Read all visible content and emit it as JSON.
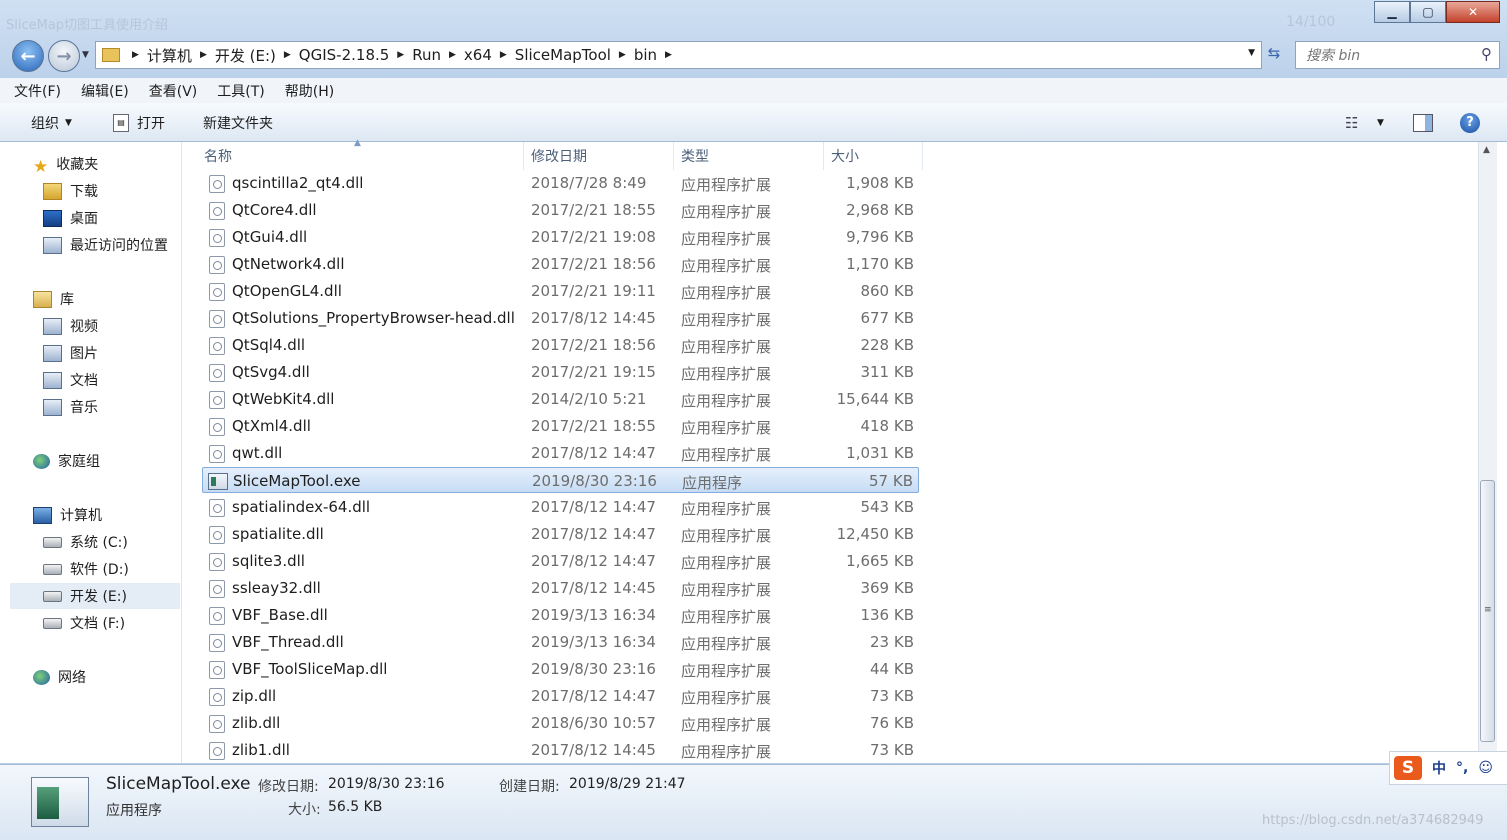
{
  "window": {
    "ghost_title_left": "SliceMap切图工具使用介绍",
    "ghost_title_right": "14/100"
  },
  "address": {
    "crumbs": [
      "计算机",
      "开发 (E:)",
      "QGIS-2.18.5",
      "Run",
      "x64",
      "SliceMapTool",
      "bin"
    ],
    "search_placeholder": "搜索 bin"
  },
  "menubar": [
    "文件(F)",
    "编辑(E)",
    "查看(V)",
    "工具(T)",
    "帮助(H)"
  ],
  "toolbar": {
    "organize": "组织",
    "open": "打开",
    "new_folder": "新建文件夹"
  },
  "nav": {
    "favorites": "收藏夹",
    "fav_items": [
      "下载",
      "桌面",
      "最近访问的位置"
    ],
    "libraries": "库",
    "lib_items": [
      "视频",
      "图片",
      "文档",
      "音乐"
    ],
    "homegroup": "家庭组",
    "computer": "计算机",
    "drives": [
      "系统 (C:)",
      "软件 (D:)",
      "开发 (E:)",
      "文档 (F:)"
    ],
    "network": "网络"
  },
  "columns": {
    "name": "名称",
    "date": "修改日期",
    "type": "类型",
    "size": "大小"
  },
  "files": [
    {
      "name": "qscintilla2_qt4.dll",
      "date": "2018/7/28 8:49",
      "type": "应用程序扩展",
      "size": "1,908 KB"
    },
    {
      "name": "QtCore4.dll",
      "date": "2017/2/21 18:55",
      "type": "应用程序扩展",
      "size": "2,968 KB"
    },
    {
      "name": "QtGui4.dll",
      "date": "2017/2/21 19:08",
      "type": "应用程序扩展",
      "size": "9,796 KB"
    },
    {
      "name": "QtNetwork4.dll",
      "date": "2017/2/21 18:56",
      "type": "应用程序扩展",
      "size": "1,170 KB"
    },
    {
      "name": "QtOpenGL4.dll",
      "date": "2017/2/21 19:11",
      "type": "应用程序扩展",
      "size": "860 KB"
    },
    {
      "name": "QtSolutions_PropertyBrowser-head.dll",
      "date": "2017/8/12 14:45",
      "type": "应用程序扩展",
      "size": "677 KB"
    },
    {
      "name": "QtSql4.dll",
      "date": "2017/2/21 18:56",
      "type": "应用程序扩展",
      "size": "228 KB"
    },
    {
      "name": "QtSvg4.dll",
      "date": "2017/2/21 19:15",
      "type": "应用程序扩展",
      "size": "311 KB"
    },
    {
      "name": "QtWebKit4.dll",
      "date": "2014/2/10 5:21",
      "type": "应用程序扩展",
      "size": "15,644 KB"
    },
    {
      "name": "QtXml4.dll",
      "date": "2017/2/21 18:55",
      "type": "应用程序扩展",
      "size": "418 KB"
    },
    {
      "name": "qwt.dll",
      "date": "2017/8/12 14:47",
      "type": "应用程序扩展",
      "size": "1,031 KB"
    },
    {
      "name": "SliceMapTool.exe",
      "date": "2019/8/30 23:16",
      "type": "应用程序",
      "size": "57 KB"
    },
    {
      "name": "spatialindex-64.dll",
      "date": "2017/8/12 14:47",
      "type": "应用程序扩展",
      "size": "543 KB"
    },
    {
      "name": "spatialite.dll",
      "date": "2017/8/12 14:47",
      "type": "应用程序扩展",
      "size": "12,450 KB"
    },
    {
      "name": "sqlite3.dll",
      "date": "2017/8/12 14:47",
      "type": "应用程序扩展",
      "size": "1,665 KB"
    },
    {
      "name": "ssleay32.dll",
      "date": "2017/8/12 14:45",
      "type": "应用程序扩展",
      "size": "369 KB"
    },
    {
      "name": "VBF_Base.dll",
      "date": "2019/3/13 16:34",
      "type": "应用程序扩展",
      "size": "136 KB"
    },
    {
      "name": "VBF_Thread.dll",
      "date": "2019/3/13 16:34",
      "type": "应用程序扩展",
      "size": "23 KB"
    },
    {
      "name": "VBF_ToolSliceMap.dll",
      "date": "2019/8/30 23:16",
      "type": "应用程序扩展",
      "size": "44 KB"
    },
    {
      "name": "zip.dll",
      "date": "2017/8/12 14:47",
      "type": "应用程序扩展",
      "size": "73 KB"
    },
    {
      "name": "zlib.dll",
      "date": "2018/6/30 10:57",
      "type": "应用程序扩展",
      "size": "76 KB"
    },
    {
      "name": "zlib1.dll",
      "date": "2017/8/12 14:45",
      "type": "应用程序扩展",
      "size": "73 KB"
    }
  ],
  "details": {
    "name": "SliceMapTool.exe",
    "type": "应用程序",
    "modified_label": "修改日期:",
    "modified": "2019/8/30 23:16",
    "created_label": "创建日期:",
    "created": "2019/8/29 21:47",
    "size_label": "大小:",
    "size": "56.5 KB"
  },
  "ime": {
    "logo": "S",
    "lang": "中",
    "punct": "°,",
    "smiley": "☺"
  },
  "watermark": "https://blog.csdn.net/a374682949"
}
